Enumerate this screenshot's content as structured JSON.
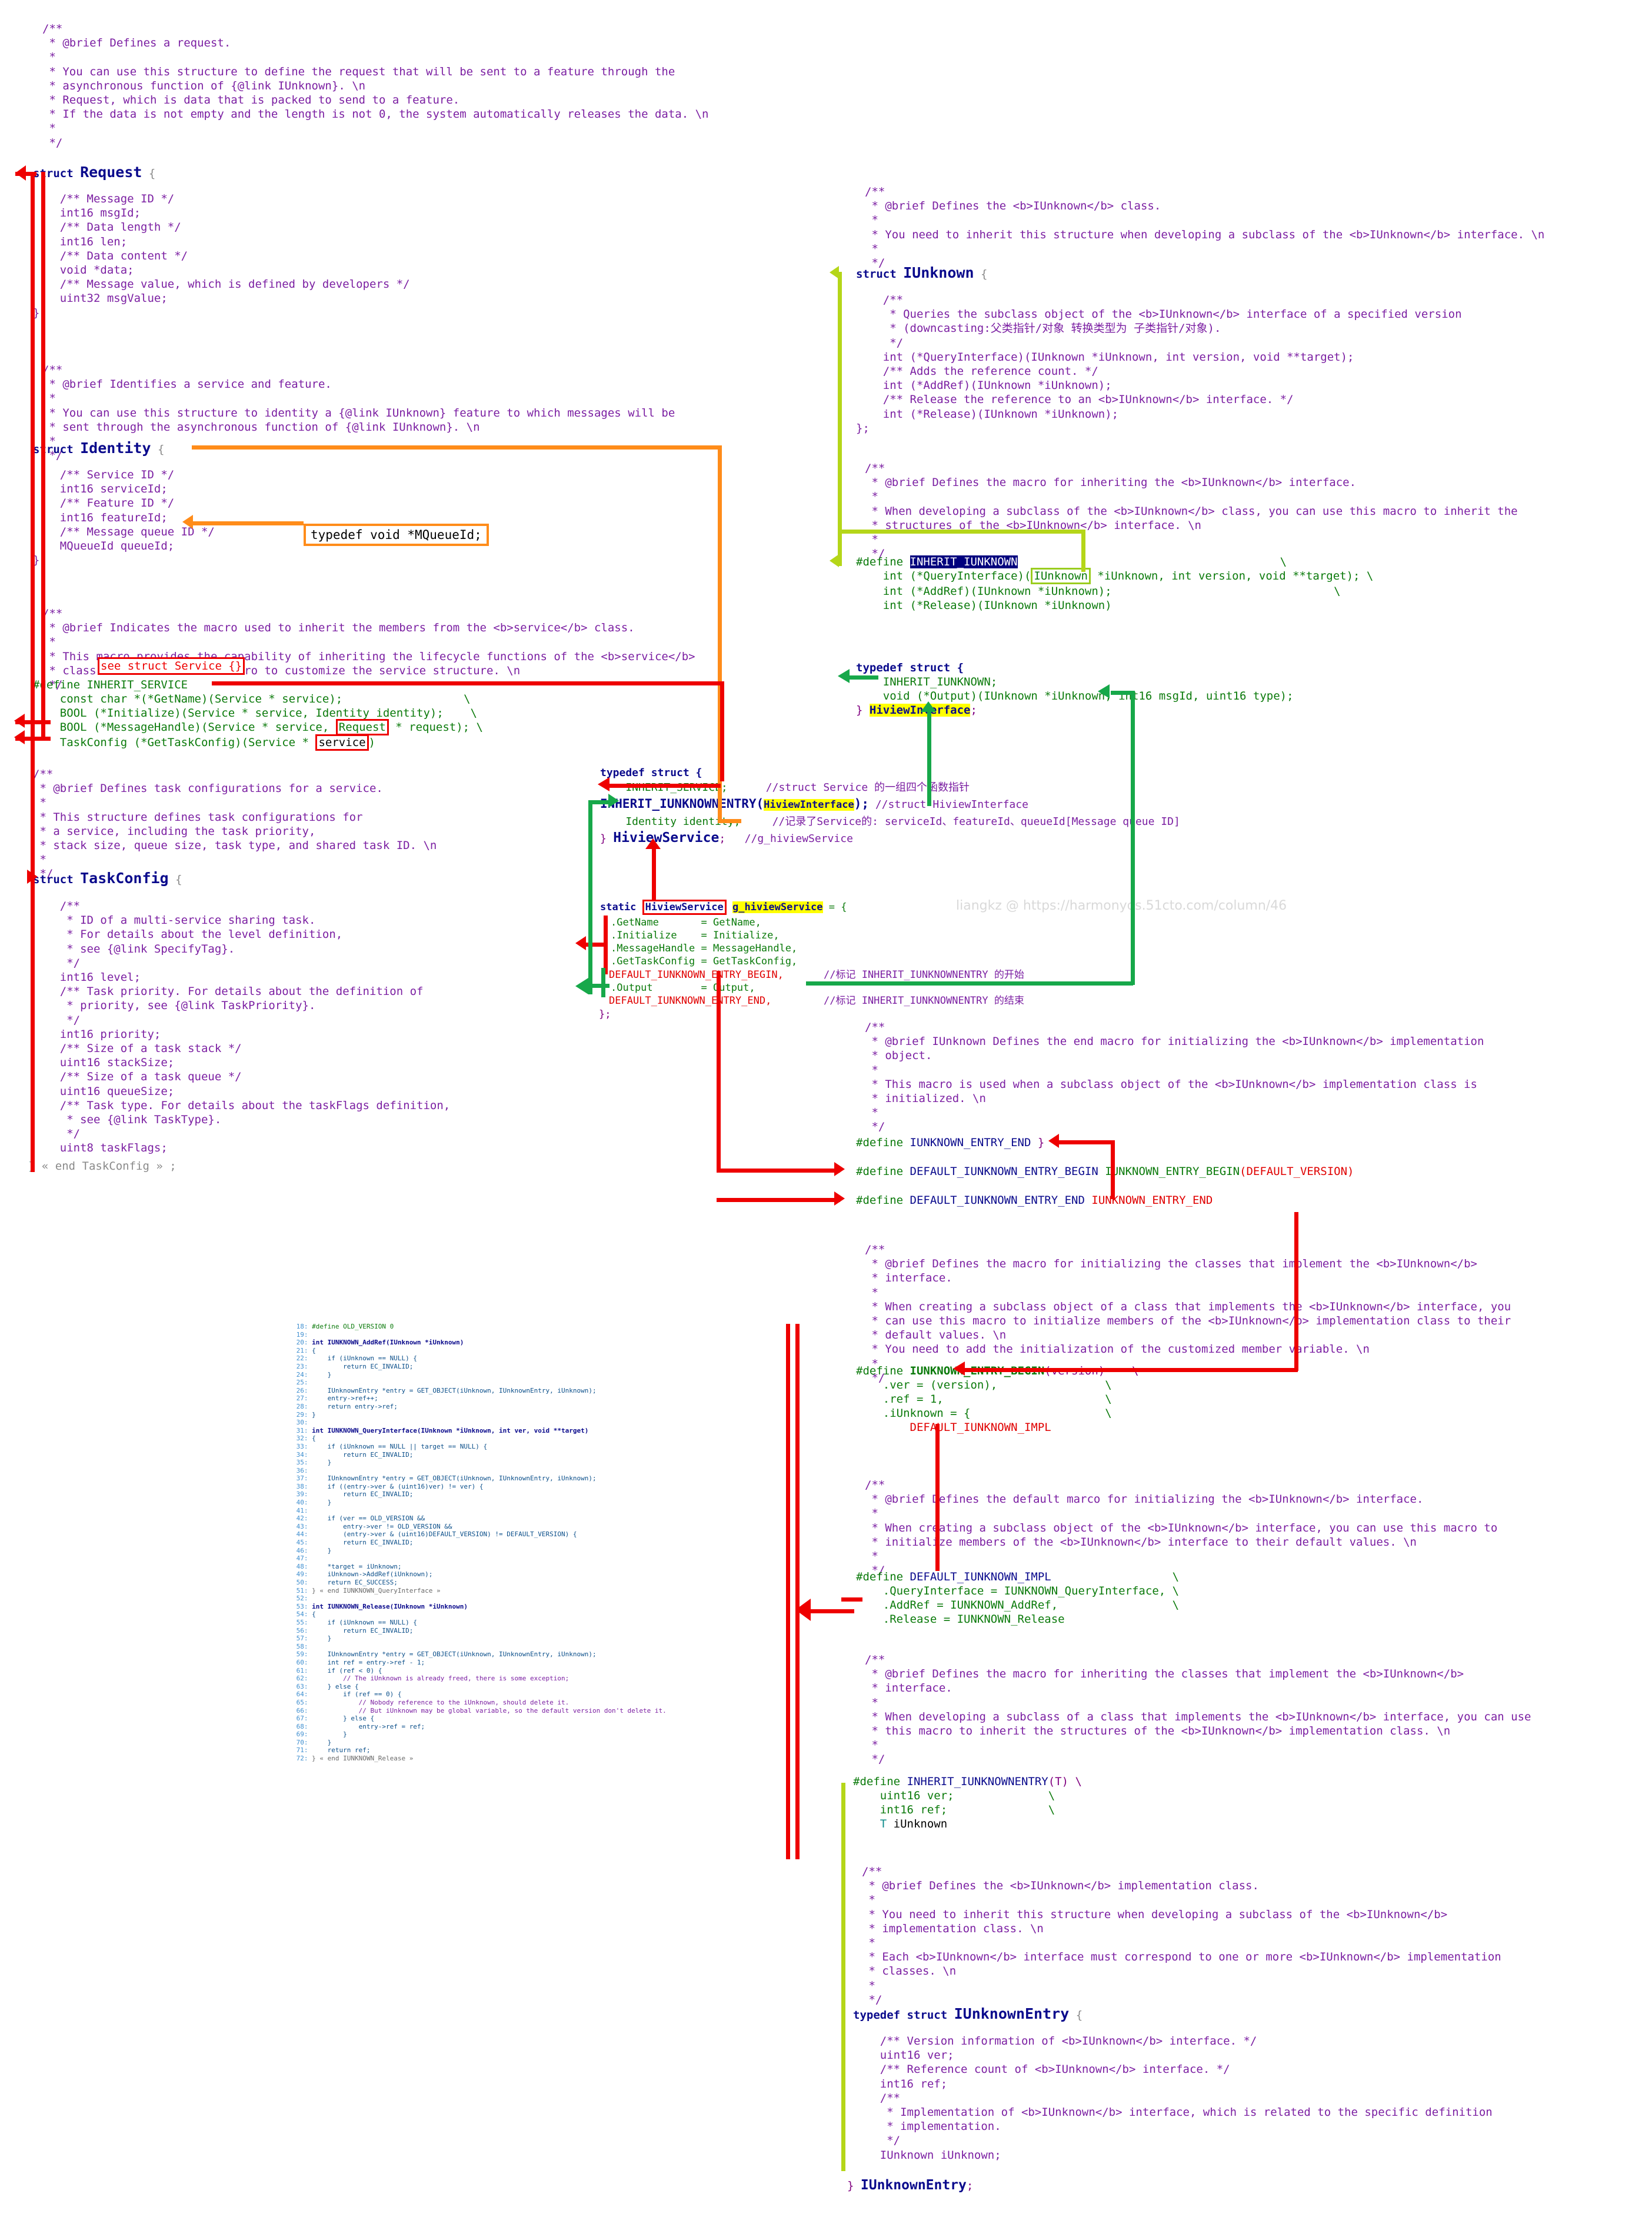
{
  "meta": {
    "watermark": "liangkz @ https://harmonyos.51cto.com/column/46",
    "colors": {
      "comment": "#7b1fa2",
      "keyword": "#0a0a8c",
      "type": "#0b7a0b",
      "macro_red": "#e00000",
      "arrow_red": "#ee0000",
      "arrow_orange": "#ff8c1a",
      "arrow_green": "#17a84a",
      "arrow_yellowgreen": "#b5d619",
      "highlight_yellow": "#ffff00",
      "highlight_navy": "#00007e"
    }
  },
  "left_column": {
    "request_doc": "/**\n * @brief Defines a request.\n *\n * You can use this structure to define the request that will be sent to a feature through the\n * asynchronous function of {@link IUnknown}. \\n\n * Request, which is data that is packed to send to a feature.\n * If the data is not empty and the length is not 0, the system automatically releases the data. \\n\n *\n */",
    "request_struct_prefix": "struct",
    "request_struct_name": "Request",
    "request_struct_brace": "{",
    "request_body": "    /** Message ID */\n    int16 msgId;\n    /** Data length */\n    int16 len;\n    /** Data content */\n    void *data;\n    /** Message value, which is defined by developers */\n    uint32 msgValue;\n};",
    "identity_doc": "/**\n * @brief Identifies a service and feature.\n *\n * You can use this structure to identity a {@link IUnknown} feature to which messages will be\n * sent through the asynchronous function of {@link IUnknown}. \\n\n *\n */",
    "identity_struct_prefix": "struct",
    "identity_struct_name": "Identity",
    "identity_struct_brace": "{",
    "identity_body": "    /** Service ID */\n    int16 serviceId;\n    /** Feature ID */\n    int16 featureId;\n    /** Message queue ID */\n    MQueueId queueId;\n};",
    "mqueueid_typedef": "typedef void *MQueueId;",
    "inherit_service_doc": "/**\n * @brief Indicates the macro used to inherit the members from the <b>service</b> class.\n *\n * This macro provides the capability of inheriting the lifecycle functions of the <b>service</b>\n * class. You can use this macro to customize the service structure. \\n\n */",
    "see_struct_service_note": "see struct Service {}",
    "inherit_service_define": "#define INHERIT_SERVICE",
    "inherit_service_body_1": "    const char *(*GetName)(Service * service);                  \\",
    "inherit_service_body_2": "    BOOL (*Initialize)(Service * service, Identity identity);    \\",
    "inherit_service_body_3a": "    BOOL (*MessageHandle)(Service * service, ",
    "inherit_service_body_3_boxed": "Request",
    "inherit_service_body_3b": " * request); \\",
    "inherit_service_body_4a": "    TaskConfig (*GetTaskConfig)(Service * ",
    "inherit_service_body_4_boxed": "service",
    "inherit_service_body_4b": ")",
    "taskconfig_doc": "/**\n * @brief Defines task configurations for a service.\n *\n * This structure defines task configurations for\n * a service, including the task priority,\n * stack size, queue size, task type, and shared task ID. \\n\n *\n */",
    "taskconfig_struct_prefix": "struct",
    "taskconfig_struct_name": "TaskConfig",
    "taskconfig_struct_brace": "{",
    "taskconfig_body": "    /**\n     * ID of a multi-service sharing task.\n     * For details about the level definition,\n     * see {@link SpecifyTag}.\n     */\n    int16 level;\n    /** Task priority. For details about the definition of\n     * priority, see {@link TaskPriority}.\n     */\n    int16 priority;\n    /** Size of a task stack */\n    uint16 stackSize;\n    /** Size of a task queue */\n    uint16 queueSize;\n    /** Task type. For details about the taskFlags definition,\n     * see {@link TaskType}.\n     */\n    uint8 taskFlags;",
    "taskconfig_end": "} « end TaskConfig » ;"
  },
  "center_column": {
    "hiviewservice_typedef_open": "typedef struct {",
    "hiviewservice_line_inherit_service": "    INHERIT_SERVICE;",
    "hiviewservice_comment_inherit_service": "//struct Service 的一组四个函数指针",
    "hiviewservice_line_entry_prefix": "INHERIT_IUNKNOWNENTRY(",
    "hiviewservice_line_entry_arg": "HiviewInterface",
    "hiviewservice_line_entry_suffix": ");",
    "hiviewservice_comment_entry": "//struct HiviewInterface",
    "hiviewservice_line_identity": "    Identity identity;",
    "hiviewservice_comment_identity": "//记录了Service的: serviceId、featureId、queueId[Message queue ID]",
    "hiviewservice_close_brace": "}",
    "hiviewservice_name": "HiviewService",
    "hiviewservice_semicolon": ";",
    "hiviewservice_comment_global": "//g_hiviewService",
    "global_static_prefix": "static ",
    "global_static_type": "HiviewService",
    "global_static_name": "g_hiviewService",
    "global_static_eq": " = {",
    "global_init_getname": ".GetName       = GetName,",
    "global_init_initialize": ".Initialize    = Initialize,",
    "global_init_messagehandle": ".MessageHandle = MessageHandle,",
    "global_init_gettaskconfig": ".GetTaskConfig = GetTaskConfig,",
    "global_init_begin": "DEFAULT_IUNKNOWN_ENTRY_BEGIN,",
    "global_init_begin_comment": "//标记 INHERIT_IUNKNOWNENTRY 的开始",
    "global_init_output": ".Output        = Output,",
    "global_init_end": "DEFAULT_IUNKNOWN_ENTRY_END,",
    "global_init_end_comment": "//标记 INHERIT_IUNKNOWNENTRY 的结束",
    "global_close": "};"
  },
  "right_column": {
    "iunknown_doc": "/**\n * @brief Defines the <b>IUnknown</b> class.\n *\n * You need to inherit this structure when developing a subclass of the <b>IUnknown</b> interface. \\n\n *\n */",
    "iunknown_struct_prefix": "struct",
    "iunknown_struct_name": "IUnknown",
    "iunknown_struct_brace": "{",
    "iunknown_body": "    /**\n     * Queries the subclass object of the <b>IUnknown</b> interface of a specified version\n     * (downcasting:父类指针/对象 转换类型为 子类指针/对象).\n     */\n    int (*QueryInterface)(IUnknown *iUnknown, int version, void **target);\n    /** Adds the reference count. */\n    int (*AddRef)(IUnknown *iUnknown);\n    /** Release the reference to an <b>IUnknown</b> interface. */\n    int (*Release)(IUnknown *iUnknown);\n};",
    "inherit_iunknown_doc": "/**\n * @brief Defines the macro for inheriting the <b>IUnknown</b> interface.\n *\n * When developing a subclass of the <b>IUnknown</b> class, you can use this macro to inherit the\n * structures of the <b>IUnknown</b> interface. \\n\n *\n */",
    "inherit_iunknown_define_kw": "#define ",
    "inherit_iunknown_define_name": "INHERIT_IUNKNOWN",
    "inherit_iunknown_l1a": "    int (*QueryInterface)(",
    "inherit_iunknown_l1_boxed": "IUnknown",
    "inherit_iunknown_l1b": " *iUnknown, int version, void **target); \\",
    "inherit_iunknown_l2": "    int (*AddRef)(IUnknown *iUnknown);                                 \\",
    "inherit_iunknown_l3": "    int (*Release)(IUnknown *iUnknown)",
    "hiviewinterface_open": "typedef struct {",
    "hiviewinterface_l1": "    INHERIT_IUNKNOWN;",
    "hiviewinterface_l2": "    void (*Output)(IUnknown *iUnknown, int16 msgId, uint16 type);",
    "hiviewinterface_close_brace": "} ",
    "hiviewinterface_name": "HiviewInterface",
    "hiviewinterface_semi": ";",
    "entry_end_doc": "/**\n * @brief IUnknown Defines the end macro for initializing the <b>IUnknown</b> implementation\n * object.\n *\n * This macro is used when a subclass object of the <b>IUnknown</b> implementation class is\n * initialized. \\n\n *\n */",
    "entry_end_define_kw": "#define ",
    "entry_end_define_name": "IUNKNOWN_ENTRY_END",
    "entry_end_define_val": " }",
    "default_begin_kw": "#define ",
    "default_begin_name": "DEFAULT_IUNKNOWN_ENTRY_BEGIN ",
    "default_begin_val1": "IUNKNOWN_ENTRY_BEGIN",
    "default_begin_val2": "(DEFAULT_VERSION)",
    "default_end_kw": "#define ",
    "default_end_name": "DEFAULT_IUNKNOWN_ENTRY_END ",
    "default_end_val": "IUNKNOWN_ENTRY_END",
    "entry_begin_doc": "/**\n * @brief Defines the macro for initializing the classes that implement the <b>IUnknown</b>\n * interface.\n *\n * When creating a subclass object of a class that implements the <b>IUnknown</b> interface, you\n * can use this macro to initialize members of the <b>IUnknown</b> implementation class to their\n * default values. \\n\n * You need to add the initialization of the customized member variable. \\n\n *\n */",
    "entry_begin_kw": "#define ",
    "entry_begin_name": "IUNKNOWN_ENTRY_BEGIN",
    "entry_begin_arg": "(version)    \\",
    "entry_begin_l1": "    .ver = (version),                \\",
    "entry_begin_l2": "    .ref = 1,                        \\",
    "entry_begin_l3": "    .iUnknown = {                    \\",
    "entry_begin_l4": "        DEFAULT_IUNKNOWN_IMPL",
    "default_impl_doc": "/**\n * @brief Defines the default marco for initializing the <b>IUnknown</b> interface.\n *\n * When creating a subclass object of the <b>IUnknown</b> interface, you can use this macro to\n * initialize members of the <b>IUnknown</b> interface to their default values. \\n\n *\n */",
    "default_impl_kw": "#define ",
    "default_impl_name": "DEFAULT_IUNKNOWN_IMPL",
    "default_impl_tail": "                  \\",
    "default_impl_l1": "    .QueryInterface = IUNKNOWN_QueryInterface, \\",
    "default_impl_l2": "    .AddRef = IUNKNOWN_AddRef,                 \\",
    "default_impl_l3": "    .Release = IUNKNOWN_Release",
    "inherit_entry_doc": "/**\n * @brief Defines the macro for inheriting the classes that implement the <b>IUnknown</b>\n * interface.\n *\n * When developing a subclass of a class that implements the <b>IUnknown</b> interface, you can use\n * this macro to inherit the structures of the <b>IUnknown</b> implementation class. \\n\n *\n */",
    "inherit_entry_kw": "#define ",
    "inherit_entry_name": "INHERIT_IUNKNOWNENTRY",
    "inherit_entry_arg": "(T) \\",
    "inherit_entry_l1": "    uint16 ver;              \\",
    "inherit_entry_l2": "    int16 ref;               \\",
    "inherit_entry_l3a": "    T",
    "inherit_entry_l3b": " iUnknown",
    "iunknownentry_doc": "/**\n * @brief Defines the <b>IUnknown</b> implementation class.\n *\n * You need to inherit this structure when developing a subclass of the <b>IUnknown</b>\n * implementation class. \\n\n *\n * Each <b>IUnknown</b> interface must correspond to one or more <b>IUnknown</b> implementation\n * classes. \\n\n *\n */",
    "iunknownentry_prefix": "typedef struct ",
    "iunknownentry_name": "IUnknownEntry",
    "iunknownentry_brace": " {",
    "iunknownentry_body": "    /** Version information of <b>IUnknown</b> interface. */\n    uint16 ver;\n    /** Reference count of <b>IUnknown</b> interface. */\n    int16 ref;\n    /**\n     * Implementation of <b>IUnknown</b> interface, which is related to the specific definition\n     * implementation.\n     */\n    IUnknown iUnknown;",
    "iunknownentry_close_brace": "} ",
    "iunknownentry_close_name": "IUnknownEntry",
    "iunknownentry_close_semi": ";"
  },
  "snippet": {
    "lines": [
      {
        "n": "18",
        "t": "#define OLD_VERSION 0"
      },
      {
        "n": "19",
        "t": ""
      },
      {
        "n": "20",
        "t": "int IUNKNOWN_AddRef(IUnknown *iUnknown)"
      },
      {
        "n": "21",
        "t": "{"
      },
      {
        "n": "22",
        "t": "    if (iUnknown == NULL) {"
      },
      {
        "n": "23",
        "t": "        return EC_INVALID;"
      },
      {
        "n": "24",
        "t": "    }"
      },
      {
        "n": "25",
        "t": ""
      },
      {
        "n": "26",
        "t": "    IUnknownEntry *entry = GET_OBJECT(iUnknown, IUnknownEntry, iUnknown);"
      },
      {
        "n": "27",
        "t": "    entry->ref++;"
      },
      {
        "n": "28",
        "t": "    return entry->ref;"
      },
      {
        "n": "29",
        "t": "}"
      },
      {
        "n": "30",
        "t": ""
      },
      {
        "n": "31",
        "t": "int IUNKNOWN_QueryInterface(IUnknown *iUnknown, int ver, void **target)"
      },
      {
        "n": "32",
        "t": "{"
      },
      {
        "n": "33",
        "t": "    if (iUnknown == NULL || target == NULL) {"
      },
      {
        "n": "34",
        "t": "        return EC_INVALID;"
      },
      {
        "n": "35",
        "t": "    }"
      },
      {
        "n": "36",
        "t": ""
      },
      {
        "n": "37",
        "t": "    IUnknownEntry *entry = GET_OBJECT(iUnknown, IUnknownEntry, iUnknown);"
      },
      {
        "n": "38",
        "t": "    if ((entry->ver & (uint16)ver) != ver) {"
      },
      {
        "n": "39",
        "t": "        return EC_INVALID;"
      },
      {
        "n": "40",
        "t": "    }"
      },
      {
        "n": "41",
        "t": ""
      },
      {
        "n": "42",
        "t": "    if (ver == OLD_VERSION &&"
      },
      {
        "n": "43",
        "t": "        entry->ver != OLD_VERSION &&"
      },
      {
        "n": "44",
        "t": "        (entry->ver & (uint16)DEFAULT_VERSION) != DEFAULT_VERSION) {"
      },
      {
        "n": "45",
        "t": "        return EC_INVALID;"
      },
      {
        "n": "46",
        "t": "    }"
      },
      {
        "n": "47",
        "t": ""
      },
      {
        "n": "48",
        "t": "    *target = iUnknown;"
      },
      {
        "n": "49",
        "t": "    iUnknown->AddRef(iUnknown);"
      },
      {
        "n": "50",
        "t": "    return EC_SUCCESS;"
      },
      {
        "n": "51",
        "t": "} « end IUNKNOWN_QueryInterface »"
      },
      {
        "n": "52",
        "t": ""
      },
      {
        "n": "53",
        "t": "int IUNKNOWN_Release(IUnknown *iUnknown)"
      },
      {
        "n": "54",
        "t": "{"
      },
      {
        "n": "55",
        "t": "    if (iUnknown == NULL) {"
      },
      {
        "n": "56",
        "t": "        return EC_INVALID;"
      },
      {
        "n": "57",
        "t": "    }"
      },
      {
        "n": "58",
        "t": ""
      },
      {
        "n": "59",
        "t": "    IUnknownEntry *entry = GET_OBJECT(iUnknown, IUnknownEntry, iUnknown);"
      },
      {
        "n": "60",
        "t": "    int ref = entry->ref - 1;"
      },
      {
        "n": "61",
        "t": "    if (ref < 0) {"
      },
      {
        "n": "62",
        "t": "        // The iUnknown is already freed, there is some exception;"
      },
      {
        "n": "63",
        "t": "    } else {"
      },
      {
        "n": "64",
        "t": "        if (ref == 0) {"
      },
      {
        "n": "65",
        "t": "            // Nobody reference to the iUnknown, should delete it."
      },
      {
        "n": "66",
        "t": "            // But iUnknown may be global variable, so the default version don't delete it."
      },
      {
        "n": "67",
        "t": "        } else {"
      },
      {
        "n": "68",
        "t": "            entry->ref = ref;"
      },
      {
        "n": "69",
        "t": "        }"
      },
      {
        "n": "70",
        "t": "    }"
      },
      {
        "n": "71",
        "t": "    return ref;"
      },
      {
        "n": "72",
        "t": "} « end IUNKNOWN_Release »"
      }
    ]
  }
}
